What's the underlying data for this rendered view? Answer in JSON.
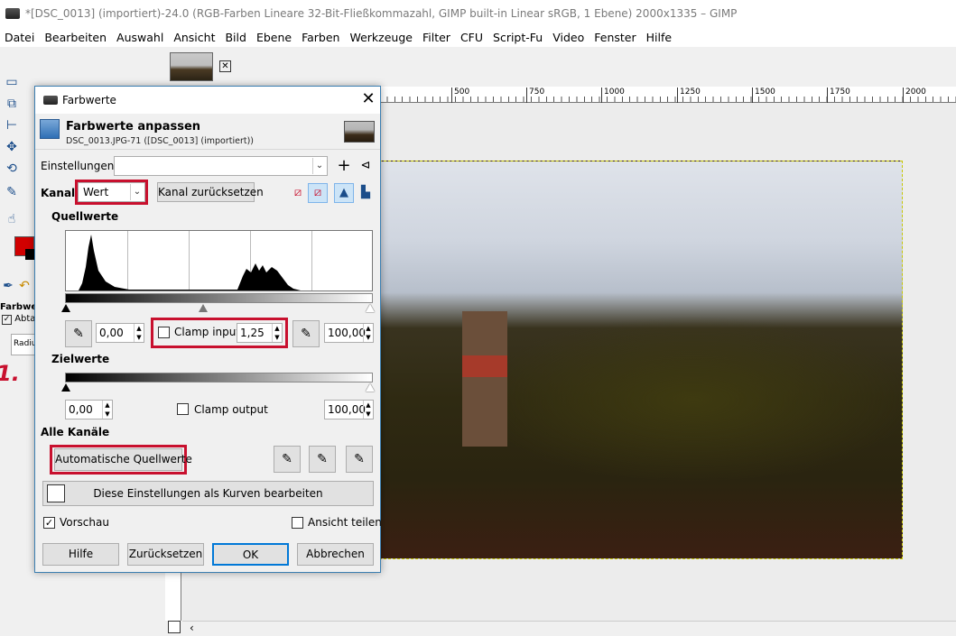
{
  "window": {
    "title": "*[DSC_0013] (importiert)-24.0 (RGB-Farben Lineare 32-Bit-Fließkommazahl, GIMP built-in Linear sRGB, 1 Ebene) 2000x1335 – GIMP"
  },
  "menu": [
    {
      "label": "Datei"
    },
    {
      "label": "Bearbeiten"
    },
    {
      "label": "Auswahl"
    },
    {
      "label": "Ansicht"
    },
    {
      "label": "Bild"
    },
    {
      "label": "Ebene"
    },
    {
      "label": "Farben"
    },
    {
      "label": "Werkzeuge"
    },
    {
      "label": "Filter"
    },
    {
      "label": "CFU"
    },
    {
      "label": "Script-Fu"
    },
    {
      "label": "Video"
    },
    {
      "label": "Fenster"
    },
    {
      "label": "Hilfe"
    }
  ],
  "left_panel": {
    "title": "Farbwer",
    "checkbox_label": "Abta",
    "field_label": "Radiu"
  },
  "ruler": {
    "labels": [
      "500",
      "750",
      "1000",
      "1250",
      "1500",
      "1750",
      "2000"
    ]
  },
  "dialog": {
    "window_title": "Farbwerte",
    "header_title": "Farbwerte anpassen",
    "header_subtitle": "DSC_0013.JPG-71 ([DSC_0013] (importiert))",
    "settings_label": "Einstellungen:",
    "settings_value": "",
    "channel_label": "Kanal:",
    "channel_value": "Wert",
    "reset_channel_button": "Kanal zurücksetzen",
    "input_section": "Quellwerte",
    "input_low": "0,00",
    "clamp_input_label": "Clamp input",
    "clamp_input_checked": false,
    "gamma": "1,25",
    "input_high": "100,00",
    "output_section": "Zielwerte",
    "output_low": "0,00",
    "clamp_output_label": "Clamp output",
    "clamp_output_checked": false,
    "output_high": "100,00",
    "all_channels_section": "Alle Kanäle",
    "auto_button": "Automatische Quellwerte",
    "curves_button": "Diese Einstellungen als Kurven bearbeiten",
    "preview_label": "Vorschau",
    "preview_checked": true,
    "split_view_label": "Ansicht teilen",
    "split_view_checked": false,
    "buttons": {
      "help": "Hilfe",
      "reset": "Zurücksetzen",
      "ok": "OK",
      "cancel": "Abbrechen"
    },
    "annotation_number": "1."
  },
  "colors": {
    "accent_red": "#c8102e",
    "foreground": "#d10000",
    "background": "#000000",
    "dialog_border": "#3c7fb1"
  }
}
